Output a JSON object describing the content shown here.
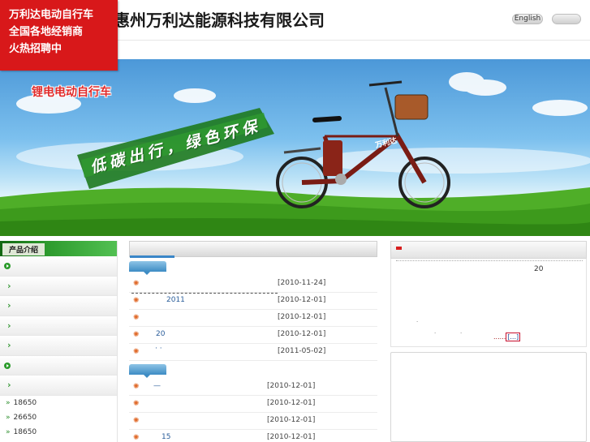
{
  "header": {
    "company_name": "惠州万利达能源科技有限公司",
    "lang_english": "English",
    "lang_other": ""
  },
  "recruit": {
    "lines": [
      "万利达电动自行车",
      "全国各地经销商",
      "火热招聘中"
    ]
  },
  "banner": {
    "tag": "锂电电动自行车",
    "slogan": "低碳出行，绿色环保",
    "bike_badge": "万利达"
  },
  "sidebar": {
    "title": "产品介绍",
    "links": [
      {
        "prefix": "»",
        "label": "18650"
      },
      {
        "prefix": "»",
        "label": "26650"
      },
      {
        "prefix": "»",
        "label": "18650"
      }
    ]
  },
  "news": {
    "group1": [
      {
        "title": "",
        "date": "[2010-11-24]"
      },
      {
        "title": "2011",
        "date": "[2010-12-01]"
      },
      {
        "title": "",
        "date": "[2010-12-01]"
      },
      {
        "title": "20",
        "date": "[2010-12-01]"
      },
      {
        "title": "·  ·",
        "date": "[2011-05-02]"
      }
    ],
    "group2": [
      {
        "title": "—",
        "date": "[2010-12-01]"
      },
      {
        "title": "",
        "date": "[2010-12-01]"
      },
      {
        "title": "",
        "date": "[2010-12-01]"
      },
      {
        "title": "15",
        "date": "[2010-12-01]"
      }
    ]
  },
  "about": {
    "number": "20",
    "more_prefix": "......",
    "more_label": "[...]"
  },
  "colors": {
    "recruit_bg": "#d8181a",
    "sidebar_green": "#2d9a2d",
    "news_link": "#2a5d9a",
    "accent_blue": "#3a86c8"
  }
}
